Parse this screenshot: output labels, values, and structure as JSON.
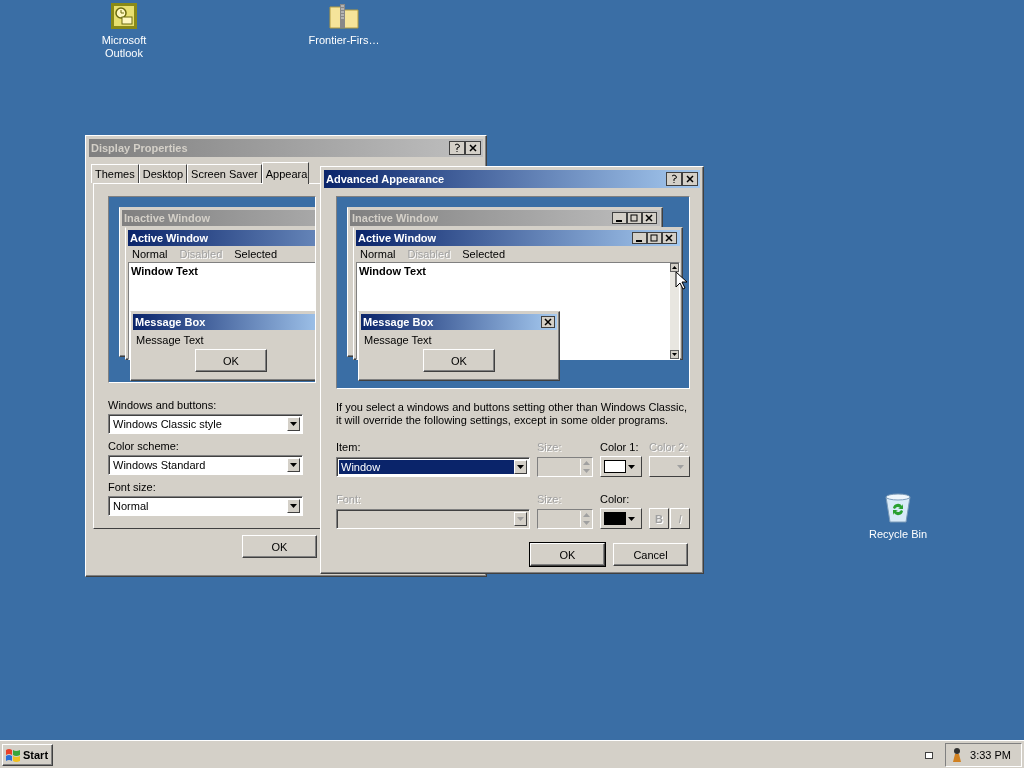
{
  "desktop_icons": [
    {
      "label": "Microsoft Outlook",
      "kind": "outlook"
    },
    {
      "label": "Frontier-Firs…",
      "kind": "zip"
    },
    {
      "label": "Recycle Bin",
      "kind": "bin"
    }
  ],
  "display_properties": {
    "title": "Display Properties",
    "active": false,
    "tabs": [
      {
        "label": "Themes",
        "selected": false
      },
      {
        "label": "Desktop",
        "selected": false
      },
      {
        "label": "Screen Saver",
        "selected": false
      },
      {
        "label": "Appeara",
        "selected": true
      }
    ],
    "preview": {
      "inactive_title": "Inactive Window",
      "active_title": "Active Window",
      "menu": [
        {
          "label": "Normal",
          "disabled": false
        },
        {
          "label": "Disabled",
          "disabled": true
        },
        {
          "label": "Selected",
          "disabled": false
        }
      ],
      "window_text": "Window Text",
      "message_box_title": "Message Box",
      "message_text": "Message Text",
      "ok": "OK"
    },
    "fields": [
      {
        "label": "Windows and buttons:",
        "value": "Windows Classic style"
      },
      {
        "label": "Color scheme:",
        "value": "Windows Standard"
      },
      {
        "label": "Font size:",
        "value": "Normal"
      }
    ],
    "ok": "OK"
  },
  "advanced_appearance": {
    "title": "Advanced Appearance",
    "active": true,
    "preview": {
      "inactive_title": "Inactive Window",
      "active_title": "Active Window",
      "menu": [
        {
          "label": "Normal",
          "disabled": false
        },
        {
          "label": "Disabled",
          "disabled": true
        },
        {
          "label": "Selected",
          "disabled": false
        }
      ],
      "window_text": "Window Text",
      "message_box_title": "Message Box",
      "message_text": "Message Text",
      "ok": "OK"
    },
    "note": "If you select a windows and buttons setting other than Windows Classic, it will override the following settings, except in some older programs.",
    "item": {
      "label": "Item:",
      "value": "Window",
      "disabled": false
    },
    "item_size": {
      "label": "Size:",
      "disabled": true
    },
    "color_1": {
      "label": "Color 1:",
      "disabled": false,
      "color": "#ffffff"
    },
    "color_2": {
      "label": "Color 2:",
      "disabled": true
    },
    "font": {
      "label": "Font:",
      "disabled": true
    },
    "font_size": {
      "label": "Size:",
      "disabled": true
    },
    "font_color": {
      "label": "Color:",
      "disabled": false,
      "color": "#000000"
    },
    "bold": {
      "label": "B",
      "disabled": true
    },
    "italic": {
      "label": "I",
      "disabled": true
    },
    "buttons": [
      "OK",
      "Cancel"
    ]
  },
  "taskbar": {
    "start": "Start",
    "clock": "3:33 PM"
  }
}
